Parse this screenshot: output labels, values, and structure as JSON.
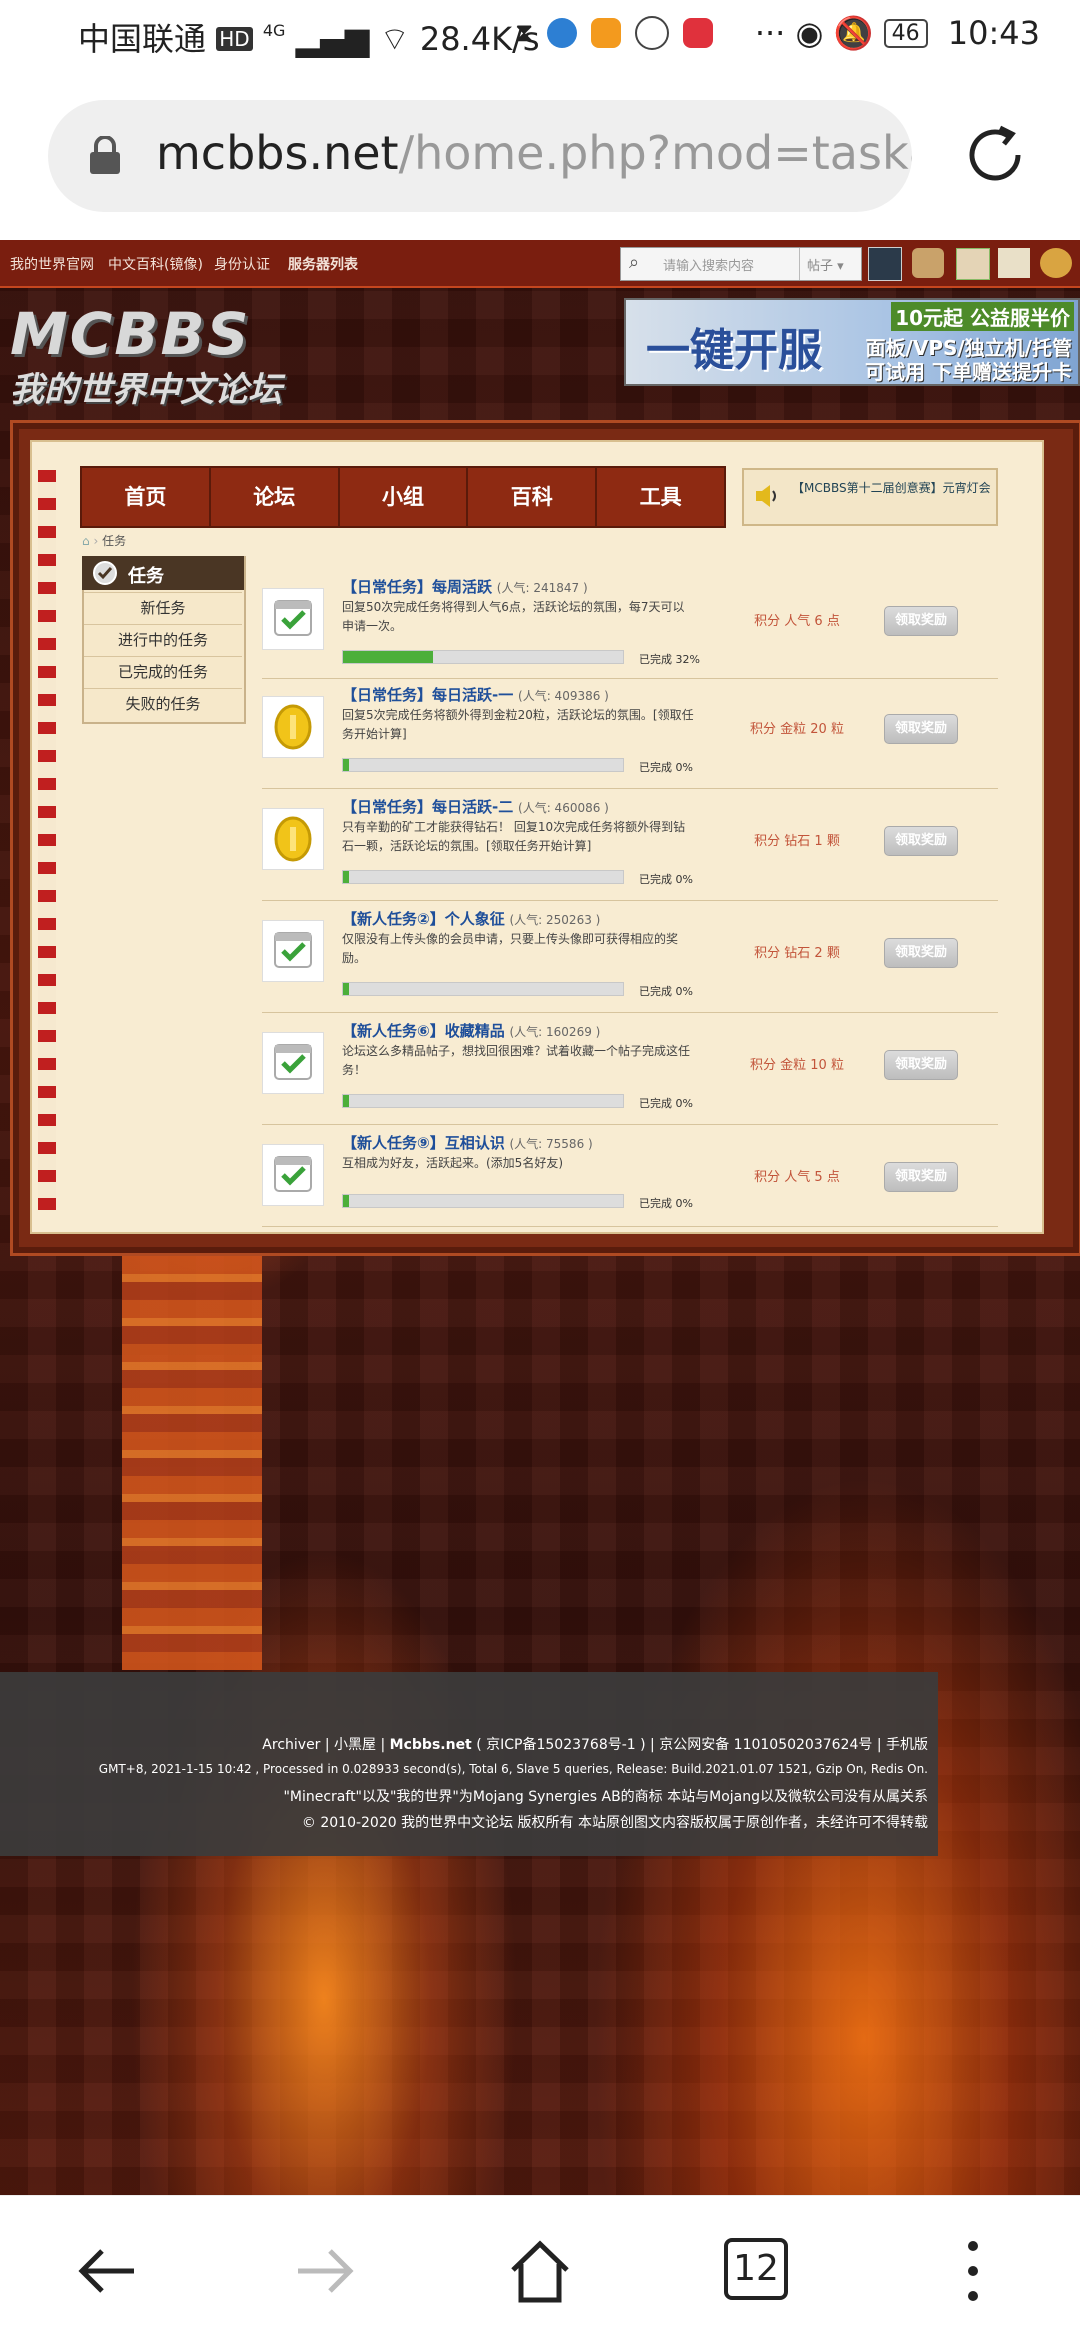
{
  "status_bar": {
    "carrier": "中国联通",
    "hd": "HD",
    "net_gen": "4G",
    "speed": "28.4K/s",
    "battery": "46",
    "time": "10:43"
  },
  "browser": {
    "url_host": "mcbbs.net",
    "url_path": "/home.php?mod=task&i",
    "tab_count": "12"
  },
  "site_nav": {
    "links": [
      "我的世界官网",
      "中文百科(镜像)",
      "身份认证",
      "服务器列表"
    ],
    "search_placeholder": "请输入搜索内容",
    "search_scope": "帖子"
  },
  "logo": {
    "en": "MCBBS",
    "cn": "我的世界中文论坛"
  },
  "banner": {
    "main": "一键开服",
    "tag": "10元起 公益服半价",
    "line1": "面板/VPS/独立机/托管",
    "line2": "可试用 下单赠送提升卡"
  },
  "main_nav": [
    "首页",
    "论坛",
    "小组",
    "百科",
    "工具"
  ],
  "notice": "【MCBBS第十二届创意赛】元宵灯会",
  "breadcrumb": "任务",
  "sidebar": {
    "title": "任务",
    "items": [
      "新任务",
      "进行中的任务",
      "已完成的任务",
      "失败的任务"
    ]
  },
  "tasks": [
    {
      "name": "【日常任务】每周活跃",
      "popularity": "(人气: 241847 )",
      "desc": "回复50次完成任务将得到人气6点，活跃论坛的氛围，每7天可以申请一次。",
      "progress_label": "已完成 32%",
      "progress": 32,
      "reward": "积分 人气 6 点",
      "claim": "领取奖励",
      "icon": "calendar-check-icon"
    },
    {
      "name": "【日常任务】每日活跃-一",
      "popularity": "(人气: 409386 )",
      "desc": "回复5次完成任务将额外得到金粒20粒，活跃论坛的氛围。[领取任务开始计算]",
      "progress_label": "已完成 0%",
      "progress": 0,
      "reward": "积分 金粒 20 粒",
      "claim": "领取奖励",
      "icon": "gold-coin-icon"
    },
    {
      "name": "【日常任务】每日活跃-二",
      "popularity": "(人气: 460086 )",
      "desc": "只有辛勤的矿工才能获得钻石！ 回复10次完成任务将额外得到钻石一颗，活跃论坛的氛围。[领取任务开始计算]",
      "progress_label": "已完成 0%",
      "progress": 0,
      "reward": "积分 钻石 1 颗",
      "claim": "领取奖励",
      "icon": "gold-coin-icon"
    },
    {
      "name": "【新人任务②】个人象征",
      "popularity": "(人气: 250263 )",
      "desc": "仅限没有上传头像的会员申请，只要上传头像即可获得相应的奖励。",
      "progress_label": "已完成 0%",
      "progress": 0,
      "reward": "积分 钻石 2 颗",
      "claim": "领取奖励",
      "icon": "calendar-check-icon"
    },
    {
      "name": "【新人任务⑥】收藏精品",
      "popularity": "(人气: 160269 )",
      "desc": "论坛这么多精品帖子，想找回很困难？试着收藏一个帖子完成这任务！",
      "progress_label": "已完成 0%",
      "progress": 0,
      "reward": "积分 金粒 10 粒",
      "claim": "领取奖励",
      "icon": "calendar-check-icon"
    },
    {
      "name": "【新人任务⑨】互相认识",
      "popularity": "(人气: 75586 )",
      "desc": "互相成为好友，活跃起来。(添加5名好友)",
      "progress_label": "已完成 0%",
      "progress": 0,
      "reward": "积分 人气 5 点",
      "claim": "领取奖励",
      "icon": "calendar-check-icon"
    }
  ],
  "footer": {
    "line1_a": "Archiver | 小黑屋 | ",
    "line1_site": "Mcbbs.net",
    "line1_b": " ( 京ICP备15023768号-1 ) | 京公网安备 11010502037624号 | 手机版",
    "line2": "GMT+8, 2021-1-15 10:42 , Processed in 0.028933 second(s), Total 6, Slave 5 queries, Release: Build.2021.01.07 1521, Gzip On, Redis On.",
    "line3": "\"Minecraft\"以及\"我的世界\"为Mojang Synergies AB的商标 本站与Mojang以及微软公司没有从属关系",
    "line4": "© 2010-2020 我的世界中文论坛 版权所有 本站原创图文内容版权属于原创作者，未经许可不得转载"
  }
}
